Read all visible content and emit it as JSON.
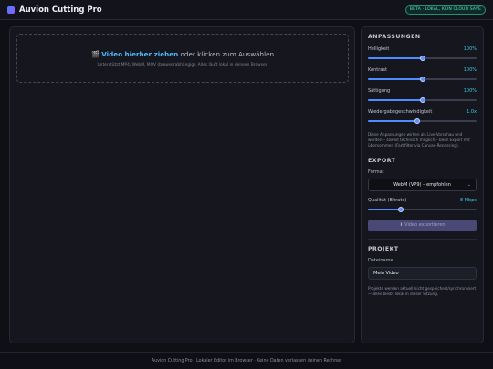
{
  "header": {
    "app_name": "Auvion Cutting Pro",
    "badge": "BETA · LOKAL, KEIN CLOUD SAVE"
  },
  "dropzone": {
    "icon": "film-icon",
    "strong": "Video hierher ziehen",
    "rest": " oder klicken zum Auswählen",
    "subtitle": "Unterstützt MP4, WebM, MOV (browserabhängig). Alles läuft lokal in deinem Browser."
  },
  "adjustments": {
    "title": "ANPASSUNGEN",
    "items": [
      {
        "label": "Helligkeit",
        "value": "100%",
        "fraction": 0.5
      },
      {
        "label": "Kontrast",
        "value": "100%",
        "fraction": 0.5
      },
      {
        "label": "Sättigung",
        "value": "100%",
        "fraction": 0.5
      },
      {
        "label": "Wiedergabegeschwindigkeit",
        "value": "1.0x",
        "fraction": 0.45
      }
    ],
    "note": "Diese Anpassungen wirken als Live-Vorschau und werden – soweit technisch möglich – beim Export mit übernommen (Farbfilter via Canvas-Rendering)."
  },
  "export": {
    "title": "EXPORT",
    "format_label": "Format",
    "format_value": "WebM (VP9) – empfohlen",
    "quality_label": "Qualität (Bitrate)",
    "quality_value": "8 Mbps",
    "quality_fraction": 0.3,
    "button_label": "⬇ Video exportieren"
  },
  "project": {
    "title": "PROJEKT",
    "name_label": "Dateiname",
    "name_value": "Mein Video",
    "note": "Projekte werden aktuell nicht gespeichert/synchronisiert — alles bleibt lokal in dieser Sitzung."
  },
  "footer": {
    "text": "Auvion Cutting Pro · Lokaler Editor im Browser · Keine Daten verlassen deinen Rechner"
  },
  "colors": {
    "accent": "#4f8cff",
    "value_text": "#3ec6e0",
    "badge": "#55e0c4"
  }
}
